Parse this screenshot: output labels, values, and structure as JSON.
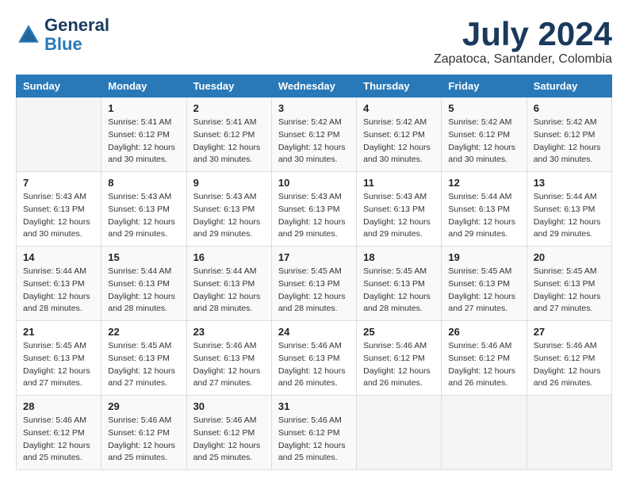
{
  "header": {
    "logo_line1": "General",
    "logo_line2": "Blue",
    "month": "July 2024",
    "location": "Zapatoca, Santander, Colombia"
  },
  "weekdays": [
    "Sunday",
    "Monday",
    "Tuesday",
    "Wednesday",
    "Thursday",
    "Friday",
    "Saturday"
  ],
  "weeks": [
    [
      {
        "day": "",
        "info": ""
      },
      {
        "day": "1",
        "info": "Sunrise: 5:41 AM\nSunset: 6:12 PM\nDaylight: 12 hours\nand 30 minutes."
      },
      {
        "day": "2",
        "info": "Sunrise: 5:41 AM\nSunset: 6:12 PM\nDaylight: 12 hours\nand 30 minutes."
      },
      {
        "day": "3",
        "info": "Sunrise: 5:42 AM\nSunset: 6:12 PM\nDaylight: 12 hours\nand 30 minutes."
      },
      {
        "day": "4",
        "info": "Sunrise: 5:42 AM\nSunset: 6:12 PM\nDaylight: 12 hours\nand 30 minutes."
      },
      {
        "day": "5",
        "info": "Sunrise: 5:42 AM\nSunset: 6:12 PM\nDaylight: 12 hours\nand 30 minutes."
      },
      {
        "day": "6",
        "info": "Sunrise: 5:42 AM\nSunset: 6:12 PM\nDaylight: 12 hours\nand 30 minutes."
      }
    ],
    [
      {
        "day": "7",
        "info": "Sunrise: 5:43 AM\nSunset: 6:13 PM\nDaylight: 12 hours\nand 30 minutes."
      },
      {
        "day": "8",
        "info": "Sunrise: 5:43 AM\nSunset: 6:13 PM\nDaylight: 12 hours\nand 29 minutes."
      },
      {
        "day": "9",
        "info": "Sunrise: 5:43 AM\nSunset: 6:13 PM\nDaylight: 12 hours\nand 29 minutes."
      },
      {
        "day": "10",
        "info": "Sunrise: 5:43 AM\nSunset: 6:13 PM\nDaylight: 12 hours\nand 29 minutes."
      },
      {
        "day": "11",
        "info": "Sunrise: 5:43 AM\nSunset: 6:13 PM\nDaylight: 12 hours\nand 29 minutes."
      },
      {
        "day": "12",
        "info": "Sunrise: 5:44 AM\nSunset: 6:13 PM\nDaylight: 12 hours\nand 29 minutes."
      },
      {
        "day": "13",
        "info": "Sunrise: 5:44 AM\nSunset: 6:13 PM\nDaylight: 12 hours\nand 29 minutes."
      }
    ],
    [
      {
        "day": "14",
        "info": "Sunrise: 5:44 AM\nSunset: 6:13 PM\nDaylight: 12 hours\nand 28 minutes."
      },
      {
        "day": "15",
        "info": "Sunrise: 5:44 AM\nSunset: 6:13 PM\nDaylight: 12 hours\nand 28 minutes."
      },
      {
        "day": "16",
        "info": "Sunrise: 5:44 AM\nSunset: 6:13 PM\nDaylight: 12 hours\nand 28 minutes."
      },
      {
        "day": "17",
        "info": "Sunrise: 5:45 AM\nSunset: 6:13 PM\nDaylight: 12 hours\nand 28 minutes."
      },
      {
        "day": "18",
        "info": "Sunrise: 5:45 AM\nSunset: 6:13 PM\nDaylight: 12 hours\nand 28 minutes."
      },
      {
        "day": "19",
        "info": "Sunrise: 5:45 AM\nSunset: 6:13 PM\nDaylight: 12 hours\nand 27 minutes."
      },
      {
        "day": "20",
        "info": "Sunrise: 5:45 AM\nSunset: 6:13 PM\nDaylight: 12 hours\nand 27 minutes."
      }
    ],
    [
      {
        "day": "21",
        "info": "Sunrise: 5:45 AM\nSunset: 6:13 PM\nDaylight: 12 hours\nand 27 minutes."
      },
      {
        "day": "22",
        "info": "Sunrise: 5:45 AM\nSunset: 6:13 PM\nDaylight: 12 hours\nand 27 minutes."
      },
      {
        "day": "23",
        "info": "Sunrise: 5:46 AM\nSunset: 6:13 PM\nDaylight: 12 hours\nand 27 minutes."
      },
      {
        "day": "24",
        "info": "Sunrise: 5:46 AM\nSunset: 6:13 PM\nDaylight: 12 hours\nand 26 minutes."
      },
      {
        "day": "25",
        "info": "Sunrise: 5:46 AM\nSunset: 6:12 PM\nDaylight: 12 hours\nand 26 minutes."
      },
      {
        "day": "26",
        "info": "Sunrise: 5:46 AM\nSunset: 6:12 PM\nDaylight: 12 hours\nand 26 minutes."
      },
      {
        "day": "27",
        "info": "Sunrise: 5:46 AM\nSunset: 6:12 PM\nDaylight: 12 hours\nand 26 minutes."
      }
    ],
    [
      {
        "day": "28",
        "info": "Sunrise: 5:46 AM\nSunset: 6:12 PM\nDaylight: 12 hours\nand 25 minutes."
      },
      {
        "day": "29",
        "info": "Sunrise: 5:46 AM\nSunset: 6:12 PM\nDaylight: 12 hours\nand 25 minutes."
      },
      {
        "day": "30",
        "info": "Sunrise: 5:46 AM\nSunset: 6:12 PM\nDaylight: 12 hours\nand 25 minutes."
      },
      {
        "day": "31",
        "info": "Sunrise: 5:46 AM\nSunset: 6:12 PM\nDaylight: 12 hours\nand 25 minutes."
      },
      {
        "day": "",
        "info": ""
      },
      {
        "day": "",
        "info": ""
      },
      {
        "day": "",
        "info": ""
      }
    ]
  ]
}
